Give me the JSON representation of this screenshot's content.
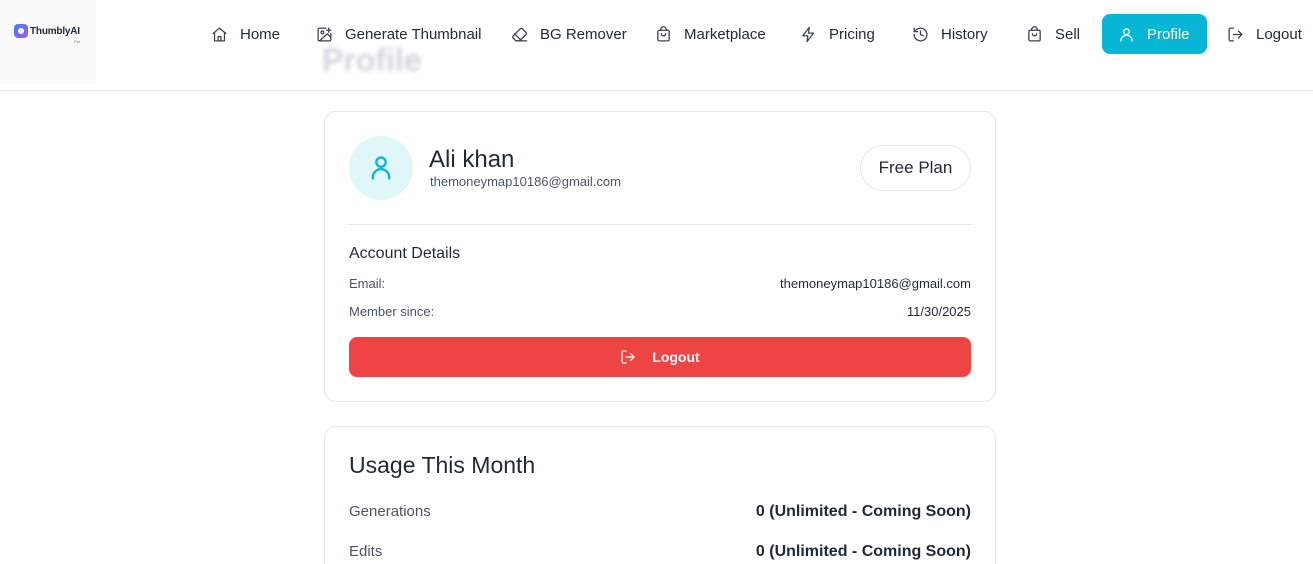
{
  "brand": {
    "name": "ThumblyAI",
    "sub": "Pro"
  },
  "page": {
    "ghost_title": "Profile"
  },
  "nav": {
    "items": [
      {
        "label": "Home",
        "icon": "home-icon"
      },
      {
        "label": "Generate Thumbnail",
        "icon": "image-plus-icon"
      },
      {
        "label": "BG Remover",
        "icon": "eraser-icon"
      },
      {
        "label": "Marketplace",
        "icon": "shopping-bag-icon"
      },
      {
        "label": "Pricing",
        "icon": "zap-icon"
      },
      {
        "label": "History",
        "icon": "history-icon"
      },
      {
        "label": "Sell",
        "icon": "shopping-bag-icon"
      },
      {
        "label": "Profile",
        "icon": "user-icon",
        "active": true
      },
      {
        "label": "Logout",
        "icon": "logout-icon"
      }
    ]
  },
  "profile": {
    "name": "Ali khan",
    "email": "themoneymap10186@gmail.com",
    "plan": "Free Plan"
  },
  "account": {
    "title": "Account Details",
    "email_label": "Email:",
    "email_value": "themoneymap10186@gmail.com",
    "member_label": "Member since:",
    "member_value": "11/30/2025",
    "logout_label": "Logout"
  },
  "usage": {
    "title": "Usage This Month",
    "rows": [
      {
        "label": "Generations",
        "value": "0 (Unlimited - Coming Soon)"
      },
      {
        "label": "Edits",
        "value": "0 (Unlimited - Coming Soon)"
      }
    ]
  },
  "colors": {
    "accent": "#06b6d4",
    "danger": "#ef4444",
    "avatar_bg": "#e0f7fa"
  }
}
